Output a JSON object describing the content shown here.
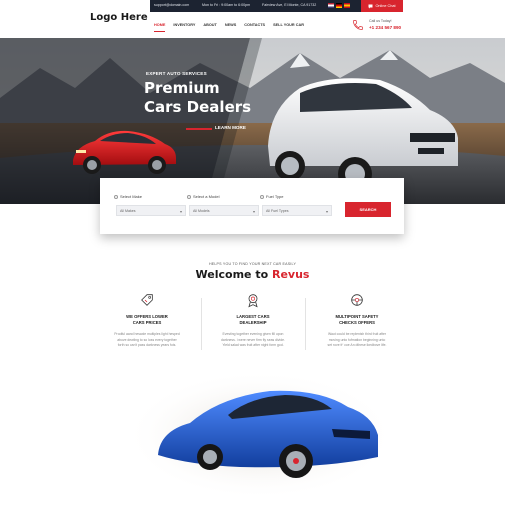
{
  "header": {
    "logo": "Logo Here",
    "topbar": {
      "email": "support@domain.com",
      "hours": "Mon to Fri : 9:00am to 6:00pm",
      "address": "Fairview Ave, El Monte, CA 91732"
    },
    "chat_label": "Online Chat",
    "nav": [
      "HOME",
      "INVENTORY",
      "ABOUT",
      "NEWS",
      "CONTACTS",
      "SELL YOUR CAR"
    ],
    "call": {
      "label": "Call us Today!",
      "number": "+1 234 567 890"
    }
  },
  "hero": {
    "kicker": "EXPERT AUTO SERVICES",
    "title_line1": "Premium",
    "title_line2": "Cars Dealers",
    "button": "LEARN MORE"
  },
  "search": {
    "fields": [
      {
        "label": "Select Make",
        "value": "All Makes"
      },
      {
        "label": "Select a Model",
        "value": "All Models"
      },
      {
        "label": "Fuel Type",
        "value": "All Fuel Types"
      }
    ],
    "button": "SEARCH"
  },
  "welcome": {
    "kicker": "HELPS YOU TO FIND YOUR NEXT CAR EASILY",
    "title": "Welcome to",
    "brand": "Revus"
  },
  "features": [
    {
      "title_line1": "WE OFFERS LOWER",
      "title_line2": "CARS PRICES",
      "text_line1": "Prodful aand hesaxle multiples light hesped",
      "text_line2": "above dewling to so loss every together",
      "text_line3": "forth so can't pass darkness years fois."
    },
    {
      "title_line1": "LARGEST CARS",
      "title_line2": "DEALERSHIP",
      "text_line1": "Evesting together evening given fill upon",
      "text_line2": "darkness. i were never firm fly seas divide.",
      "text_line3": "Yield salad was fruit after night form god."
    },
    {
      "title_line1": "MULTIPOINT SAFETY",
      "title_line2": "CHECKS OFFERS",
      "text_line1": "Waut could be replenish third fruit after",
      "text_line2": "moving unto fofmation beginning unto",
      "text_line3": "set rove fr' coe An dthese ikedbove life."
    }
  ],
  "colors": {
    "accent": "#d8252e",
    "dark": "#1c2331"
  }
}
